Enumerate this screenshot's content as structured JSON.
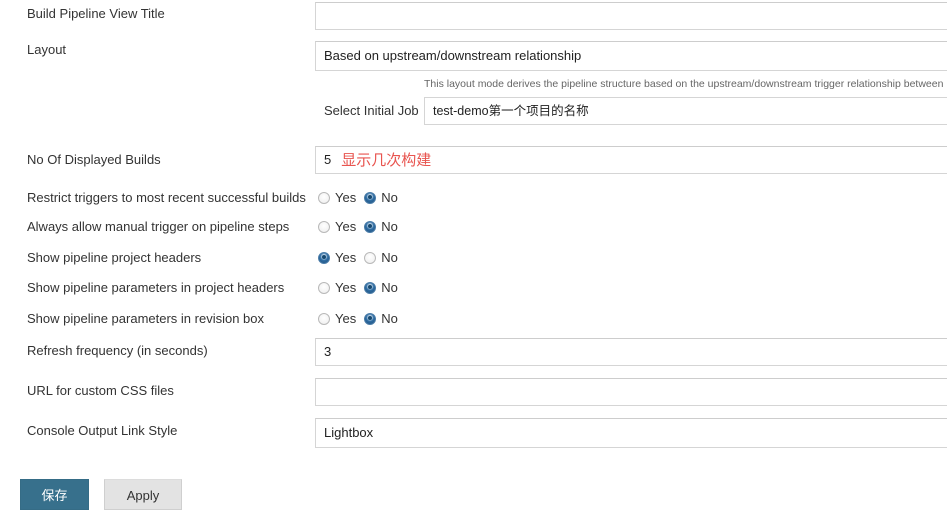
{
  "form": {
    "rows": [
      {
        "label": "Build Pipeline View Title",
        "value": "",
        "annotation": ""
      },
      {
        "label": "Layout",
        "value": "Based on upstream/downstream relationship",
        "annotation": ""
      },
      {
        "label": "No Of Displayed Builds",
        "value": "5",
        "annotation": "显示几次构建"
      },
      {
        "label": "Refresh frequency (in seconds)",
        "value": "3",
        "annotation": ""
      },
      {
        "label": "URL for custom CSS files",
        "value": "",
        "annotation": ""
      },
      {
        "label": "Console Output Link Style",
        "value": "Lightbox",
        "annotation": ""
      }
    ],
    "layout_help": "This layout mode derives the pipeline structure based on the upstream/downstream trigger relationship between",
    "initial_job": {
      "label": "Select Initial Job",
      "value": "test-demo",
      "annotation": "第一个项目的名称"
    },
    "radio_rows": [
      {
        "label": "Restrict triggers to most recent successful builds",
        "yes_label": "Yes",
        "no_label": "No",
        "selected": "No"
      },
      {
        "label": "Always allow manual trigger on pipeline steps",
        "yes_label": "Yes",
        "no_label": "No",
        "selected": "No"
      },
      {
        "label": "Show pipeline project headers",
        "yes_label": "Yes",
        "no_label": "No",
        "selected": "Yes"
      },
      {
        "label": "Show pipeline parameters in project headers",
        "yes_label": "Yes",
        "no_label": "No",
        "selected": "No"
      },
      {
        "label": "Show pipeline parameters in revision box",
        "yes_label": "Yes",
        "no_label": "No",
        "selected": "No"
      }
    ],
    "buttons": {
      "save_label": "保存",
      "apply_label": "Apply"
    },
    "colors": {
      "annotation_red": "#e8544f",
      "save_button": "#37708c",
      "apply_button": "#e3e3e3",
      "radio_selected": "#2f6da3"
    }
  }
}
